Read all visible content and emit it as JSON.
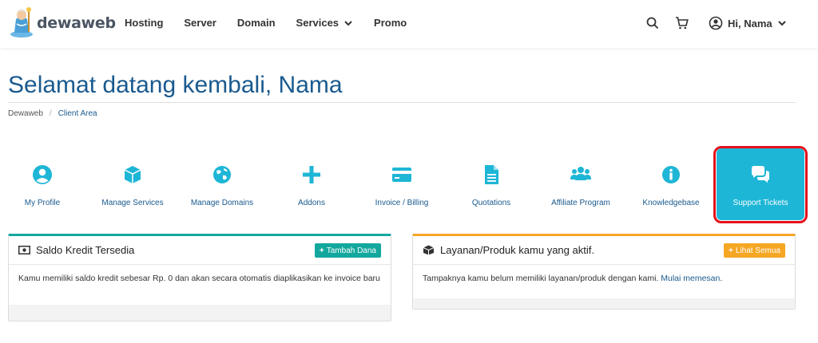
{
  "brand": {
    "name": "dewaweb"
  },
  "nav": [
    {
      "label": "Hosting"
    },
    {
      "label": "Server"
    },
    {
      "label": "Domain"
    },
    {
      "label": "Services"
    },
    {
      "label": "Promo"
    }
  ],
  "user": {
    "greeting": "Hi, Nama"
  },
  "page": {
    "title": "Selamat datang kembali, Nama"
  },
  "breadcrumb": {
    "home": "Dewaweb",
    "sep": "/",
    "current": "Client Area"
  },
  "tiles": [
    {
      "label": "My Profile",
      "icon": "user-circle-icon"
    },
    {
      "label": "Manage Services",
      "icon": "cube-icon"
    },
    {
      "label": "Manage Domains",
      "icon": "globe-icon"
    },
    {
      "label": "Addons",
      "icon": "plus-icon"
    },
    {
      "label": "Invoice / Billing",
      "icon": "credit-card-icon"
    },
    {
      "label": "Quotations",
      "icon": "document-icon"
    },
    {
      "label": "Affiliate Program",
      "icon": "users-icon"
    },
    {
      "label": "Knowledgebase",
      "icon": "info-icon"
    },
    {
      "label": "Support Tickets",
      "icon": "comments-icon"
    }
  ],
  "credit_panel": {
    "title": "Saldo Kredit Tersedia",
    "button": "Tambah Dana",
    "body": "Kamu memiliki saldo kredit sebesar Rp. 0 dan akan secara otomatis diaplikasikan ke invoice baru"
  },
  "services_panel": {
    "title": "Layanan/Produk kamu yang aktif.",
    "button": "Lihat Semua",
    "body": "Tampaknya kamu belum memiliki layanan/produk dengan kami.",
    "link": "Mulai memesan",
    "link_suffix": "."
  },
  "colors": {
    "accent": "#1a5a8f",
    "icon": "#1eb6d6",
    "green": "#13a89e",
    "orange": "#f5a623",
    "highlight": "#e4111b"
  }
}
